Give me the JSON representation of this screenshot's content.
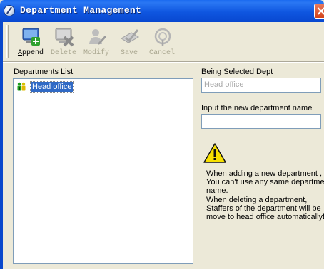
{
  "window": {
    "title": "Department Management"
  },
  "toolbar": {
    "append": {
      "label": "Append",
      "enabled": true,
      "mnemonic": "A",
      "icon": "append-icon"
    },
    "delete": {
      "label": "Delete",
      "enabled": false,
      "icon": "delete-icon"
    },
    "modify": {
      "label": "Modify",
      "enabled": false,
      "icon": "modify-icon"
    },
    "save": {
      "label": "Save",
      "enabled": false,
      "icon": "save-icon"
    },
    "cancel": {
      "label": "Cancel",
      "enabled": false,
      "icon": "cancel-icon"
    }
  },
  "departments": {
    "label": "Departments List",
    "items": [
      {
        "name": "Head office",
        "selected": true
      }
    ]
  },
  "selected_dept": {
    "label": "Being Selected Dept",
    "value": "Head office"
  },
  "new_dept": {
    "label": "Input the new department name",
    "value": ""
  },
  "notice": {
    "lines": [
      "When adding a new department ,",
      "You can't use any same departmen",
      "name.",
      "When deleting a department,",
      "Staffers of the department will be",
      "move to head office automatically!"
    ]
  },
  "colors": {
    "titlebar": "#0848d0",
    "selection": "#316ac5",
    "dialog_bg": "#ece9d8",
    "close": "#d2431a"
  }
}
